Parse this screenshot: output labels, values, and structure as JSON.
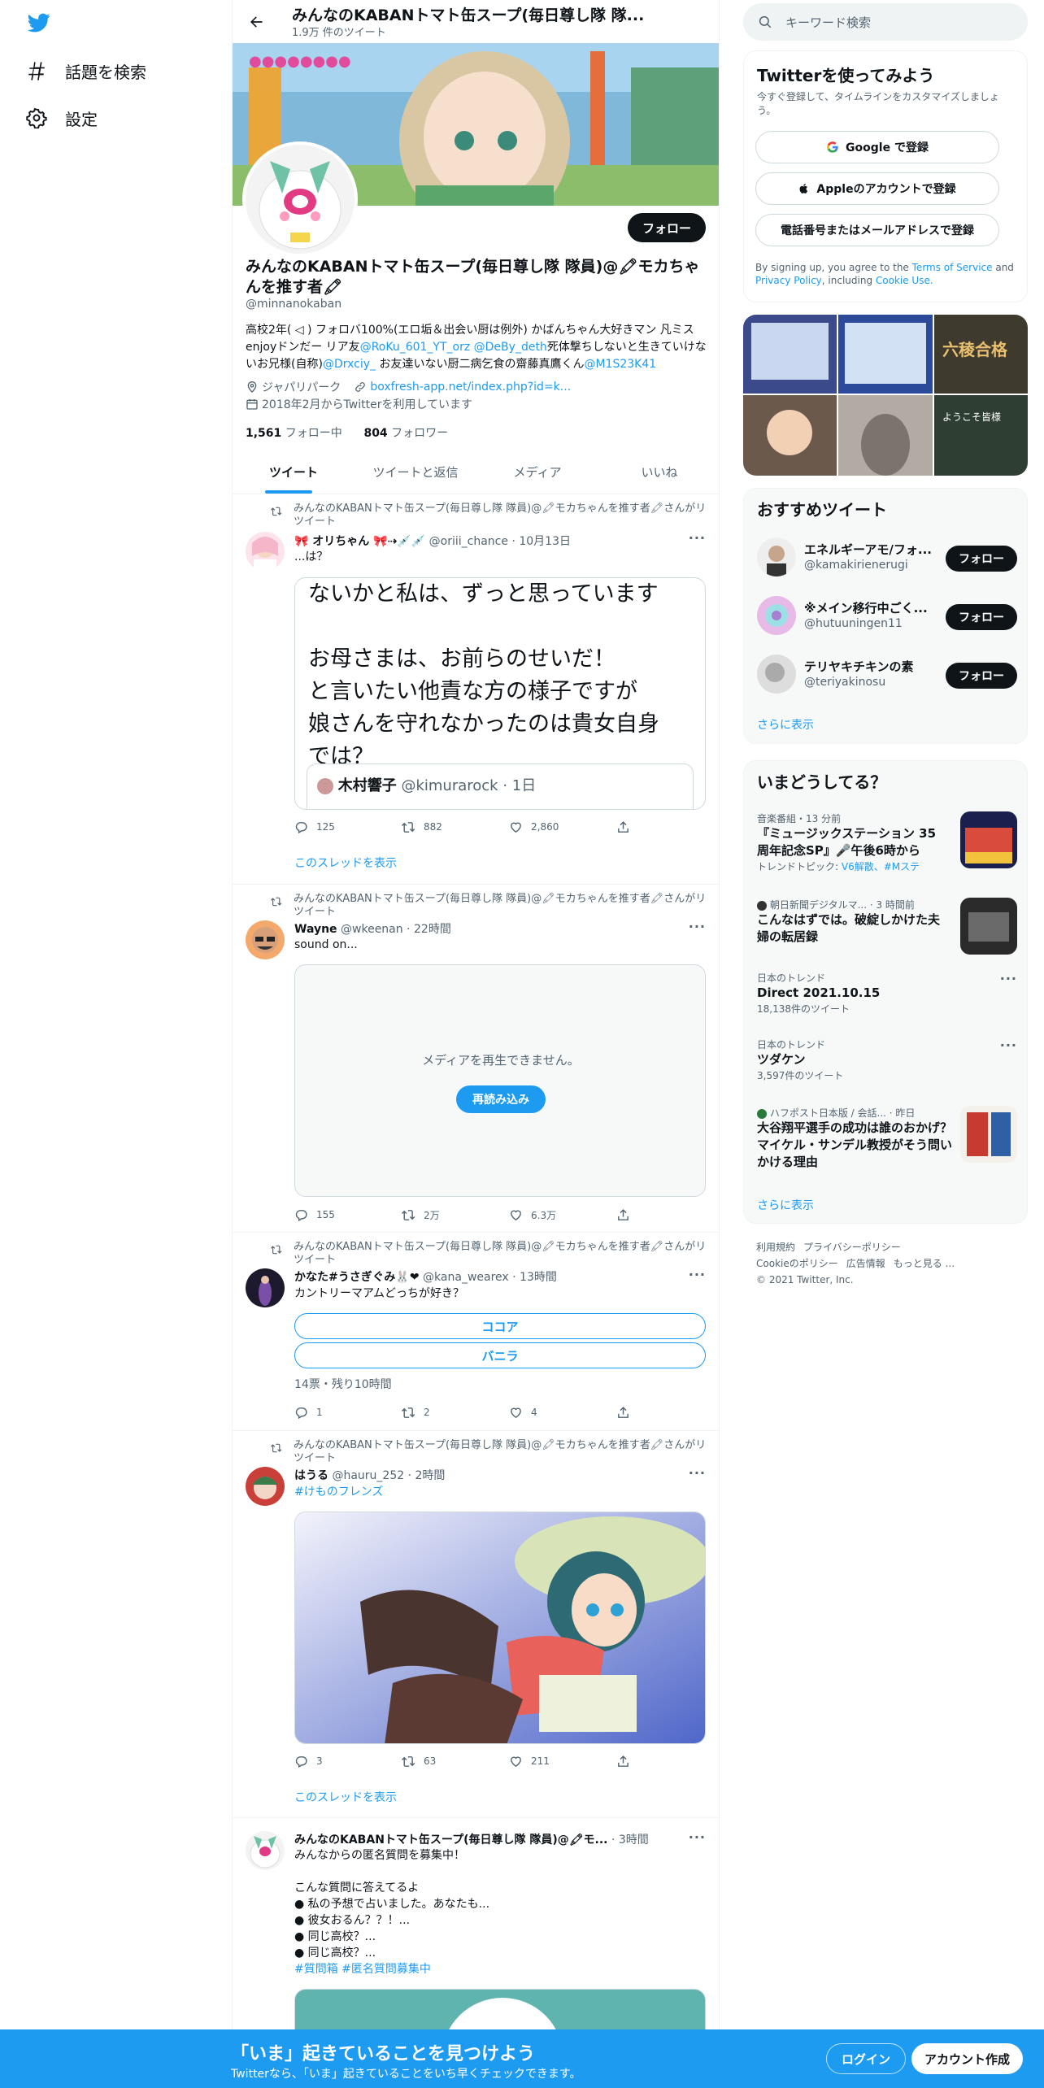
{
  "nav": {
    "explore": "話題を検索",
    "settings": "設定"
  },
  "profile": {
    "header_title": "みんなのKABANトマト缶スープ(毎日尊し隊 隊...",
    "tweet_count": "1.9万 件のツイート",
    "follow": "フォロー",
    "name": "みんなのKABANトマト缶スープ(毎日尊し隊 隊員)@🖍モカちゃんを推す者🖍",
    "handle": "@minnanokaban",
    "bio_1": "高校2年( ◁ ) フォロバ100%(エロ垢＆出会い厨は例外) かばんちゃん大好きマン 凡ミスenjoyドンだー リア友",
    "bio_link1": "@RoKu_601_YT_orz",
    "bio_link2": "@DeBy_deth",
    "bio_2": "死体撃ちしないと生きていけないお兄様(自称)",
    "bio_link3": "@Drxciy_",
    "bio_3": " お友達いない厨二病乞食の齋藤真鷹くん",
    "bio_link4": "@M1S23K41",
    "location": "ジャパリパーク",
    "url": "boxfresh-app.net/index.php?id=k...",
    "joined": "2018年2月からTwitterを利用しています",
    "following_count": "1,561",
    "following_label": "フォロー中",
    "followers_count": "804",
    "followers_label": "フォロワー"
  },
  "tabs": [
    "ツイート",
    "ツイートと返信",
    "メディア",
    "いいね"
  ],
  "retweet_label": "みんなのKABANトマト缶スープ(毎日尊し隊 隊員)@🖍モカちゃんを推す者🖍さんがリツイート",
  "show_thread": "このスレッドを表示",
  "tweets": [
    {
      "name": "🎀 オリちゃん 🎀⇢💉💉",
      "handle": "@oriii_chance",
      "time": "10月13日",
      "text": "...は？",
      "quote_text": "ないかと私は、ずっと思っています\n\nお母さまは、お前らのせいだ！\nと言いたい他責な方の様子ですが\n娘さんを守れなかったのは貴女自身\nでは？",
      "quote_name": "木村響子",
      "quote_handle": "@kimurarock · 1日",
      "replies": "125",
      "retweets": "882",
      "likes": "2,860"
    },
    {
      "name": "Wayne",
      "handle": "@wkeenan",
      "time": "22時間",
      "text": "sound on...",
      "media_error": "メディアを再生できません。",
      "reload": "再読み込み",
      "replies": "155",
      "retweets": "2万",
      "likes": "6.3万"
    },
    {
      "name": "かなた#うさぎぐみ🐰❤",
      "handle": "@kana_wearex",
      "time": "13時間",
      "text": "カントリーマアムどっちが好き？",
      "poll_options": [
        "ココア",
        "バニラ"
      ],
      "poll_meta": "14票・残り10時間",
      "replies": "1",
      "retweets": "2",
      "likes": "4"
    },
    {
      "name": "はうる",
      "handle": "@hauru_252",
      "time": "2時間",
      "text": "#けものフレンズ",
      "replies": "3",
      "retweets": "63",
      "likes": "211"
    },
    {
      "name": "みんなのKABANトマト缶スープ(毎日尊し隊 隊員)@🖍モ...",
      "time": "3時間",
      "text_1": "みんなからの匿名質問を募集中！",
      "text_2": "こんな質問に答えてるよ",
      "text_3": "● 私の予想で占いました。あなたも...",
      "text_4": "● 彼女おるん？？！...",
      "text_5": "● 同じ高校？...",
      "text_6": "● 同じ高校？...",
      "text_7": "#質問箱 #匿名質問募集中"
    }
  ],
  "right": {
    "search_placeholder": "キーワード検索",
    "signup_title": "Twitterを使ってみよう",
    "signup_sub": "今すぐ登録して、タイムラインをカスタマイズしましょう。",
    "google": "Google で登録",
    "apple": "Appleのアカウントで登録",
    "phone": "電話番号またはメールアドレスで登録",
    "terms_1": "By signing up, you agree to the ",
    "terms_link1": "Terms of Service",
    "terms_2": " and ",
    "terms_link2": "Privacy Policy",
    "terms_3": ", including ",
    "terms_link3": "Cookie Use.",
    "rec_title": "おすすめツイート",
    "rec": [
      {
        "name": "エネルギーアモ/フォ...",
        "handle": "@kamakirienerugi",
        "btn": "フォロー"
      },
      {
        "name": "※メイン移行中ごく...",
        "handle": "@hutuuningen11",
        "btn": "フォロー"
      },
      {
        "name": "テリヤキチキンの素",
        "handle": "@teriyakinosu",
        "btn": "フォロー"
      }
    ],
    "more": "さらに表示",
    "trends_title": "いまどうしてる？",
    "trends": [
      {
        "ctx": "音楽番組・13 分前",
        "title": "『ミュージックステーション 35周年記念SP』🎤午後6時から",
        "sub_pre": "トレンドトピック: ",
        "sub_links": "V6解散、#Mステ"
      },
      {
        "ctx": "朝日新聞デジタルマ... · 3 時間前",
        "title": "こんなはずでは。破綻しかけた夫婦の転居録"
      },
      {
        "ctx": "日本のトレンド",
        "title": "Direct 2021.10.15",
        "count": "18,138件のツイート"
      },
      {
        "ctx": "日本のトレンド",
        "title": "ツダケン",
        "count": "3,597件のツイート"
      },
      {
        "ctx": "ハフポスト日本版 / 会話... · 昨日",
        "title": "大谷翔平選手の成功は誰のおかげ？ マイケル・サンデル教授がそう問いかける理由"
      }
    ],
    "footer_1": [
      "利用規約",
      "プライバシーポリシー"
    ],
    "footer_2": [
      "Cookieのポリシー",
      "広告情報",
      "もっと見る ..."
    ],
    "copyright": "© 2021 Twitter, Inc."
  },
  "bottom": {
    "title": "「いま」起きていることを見つけよう",
    "sub": "Twitterなら、「いま」起きていることをいち早くチェックできます。",
    "login": "ログイン",
    "signup": "アカウント作成"
  },
  "colors": {
    "accent": "#1d9bf0",
    "text": "#0f1419",
    "muted": "#536471"
  }
}
